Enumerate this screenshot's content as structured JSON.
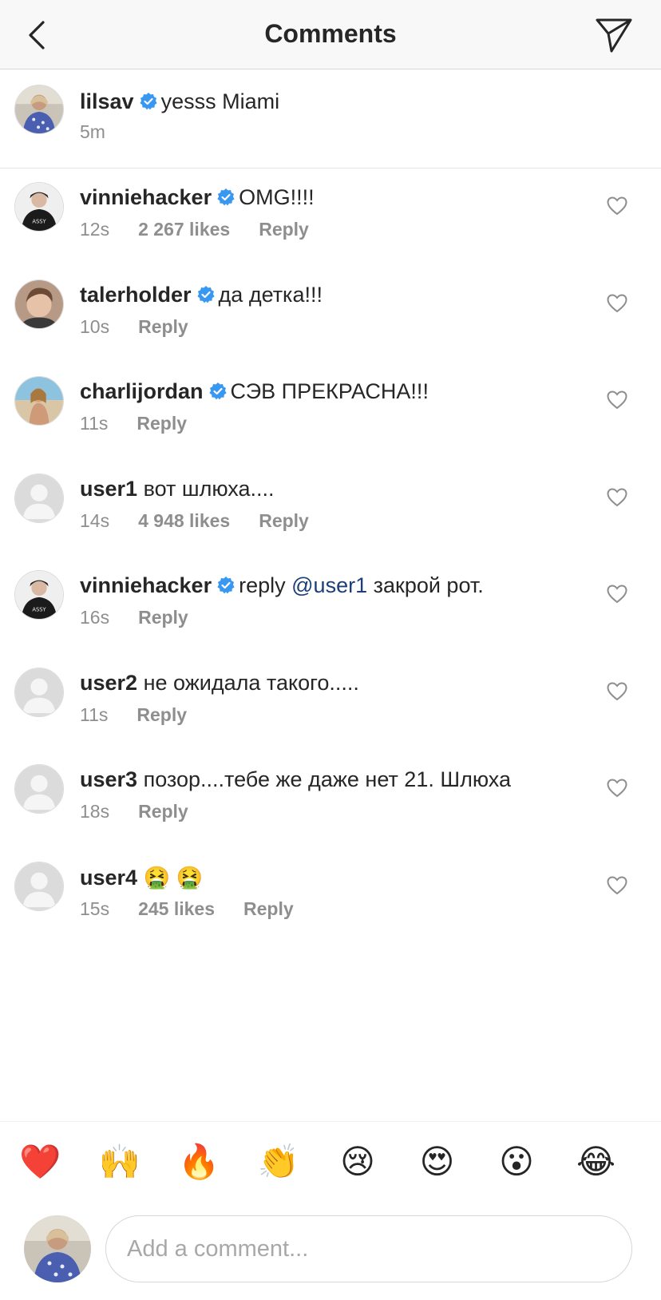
{
  "header": {
    "title": "Comments",
    "back_icon": "chevron-left-icon",
    "send_icon": "paper-plane-icon"
  },
  "caption": {
    "username": "lilsav",
    "verified": true,
    "text": "yesss Miami",
    "time": "5m"
  },
  "comments": [
    {
      "username": "vinniehacker",
      "verified": true,
      "text": "OMG!!!!",
      "time": "12s",
      "likes": "2 267 likes",
      "reply": "Reply",
      "avatar": "photo-dark"
    },
    {
      "username": "talerholder",
      "verified": true,
      "text": "да детка!!!",
      "time": "10s",
      "likes": "",
      "reply": "Reply",
      "avatar": "photo-portrait"
    },
    {
      "username": "charlijordan",
      "verified": true,
      "text": "СЭВ ПРЕКРАСНА!!!",
      "time": "11s",
      "likes": "",
      "reply": "Reply",
      "avatar": "photo-beach"
    },
    {
      "username": "user1",
      "verified": false,
      "text": "вот шлюха....",
      "time": "14s",
      "likes": "4 948 likes",
      "reply": "Reply",
      "avatar": "default"
    },
    {
      "username": "vinniehacker",
      "verified": true,
      "text_prefix": "reply",
      "mention": "@user1",
      "text": "закрой рот.",
      "time": "16s",
      "likes": "",
      "reply": "Reply",
      "avatar": "photo-dark"
    },
    {
      "username": "user2",
      "verified": false,
      "text": "не ожидала такого.....",
      "time": "11s",
      "likes": "",
      "reply": "Reply",
      "avatar": "default"
    },
    {
      "username": "user3",
      "verified": false,
      "text": "позор....тебе же даже нет 21. Шлюха",
      "time": "18s",
      "likes": "",
      "reply": "Reply",
      "avatar": "default"
    },
    {
      "username": "user4",
      "verified": false,
      "text": "🤮 🤮",
      "time": "15s",
      "likes": "245 likes",
      "reply": "Reply",
      "avatar": "default"
    }
  ],
  "emoji_bar": [
    "❤️",
    "🙌",
    "🔥",
    "👏",
    "😢",
    "😍",
    "😮",
    "😂"
  ],
  "composer": {
    "placeholder": "Add a comment..."
  },
  "colors": {
    "verified": "#3897f0",
    "mention": "#1c3f7a",
    "meta": "#8e8e8e",
    "text": "#262626"
  }
}
